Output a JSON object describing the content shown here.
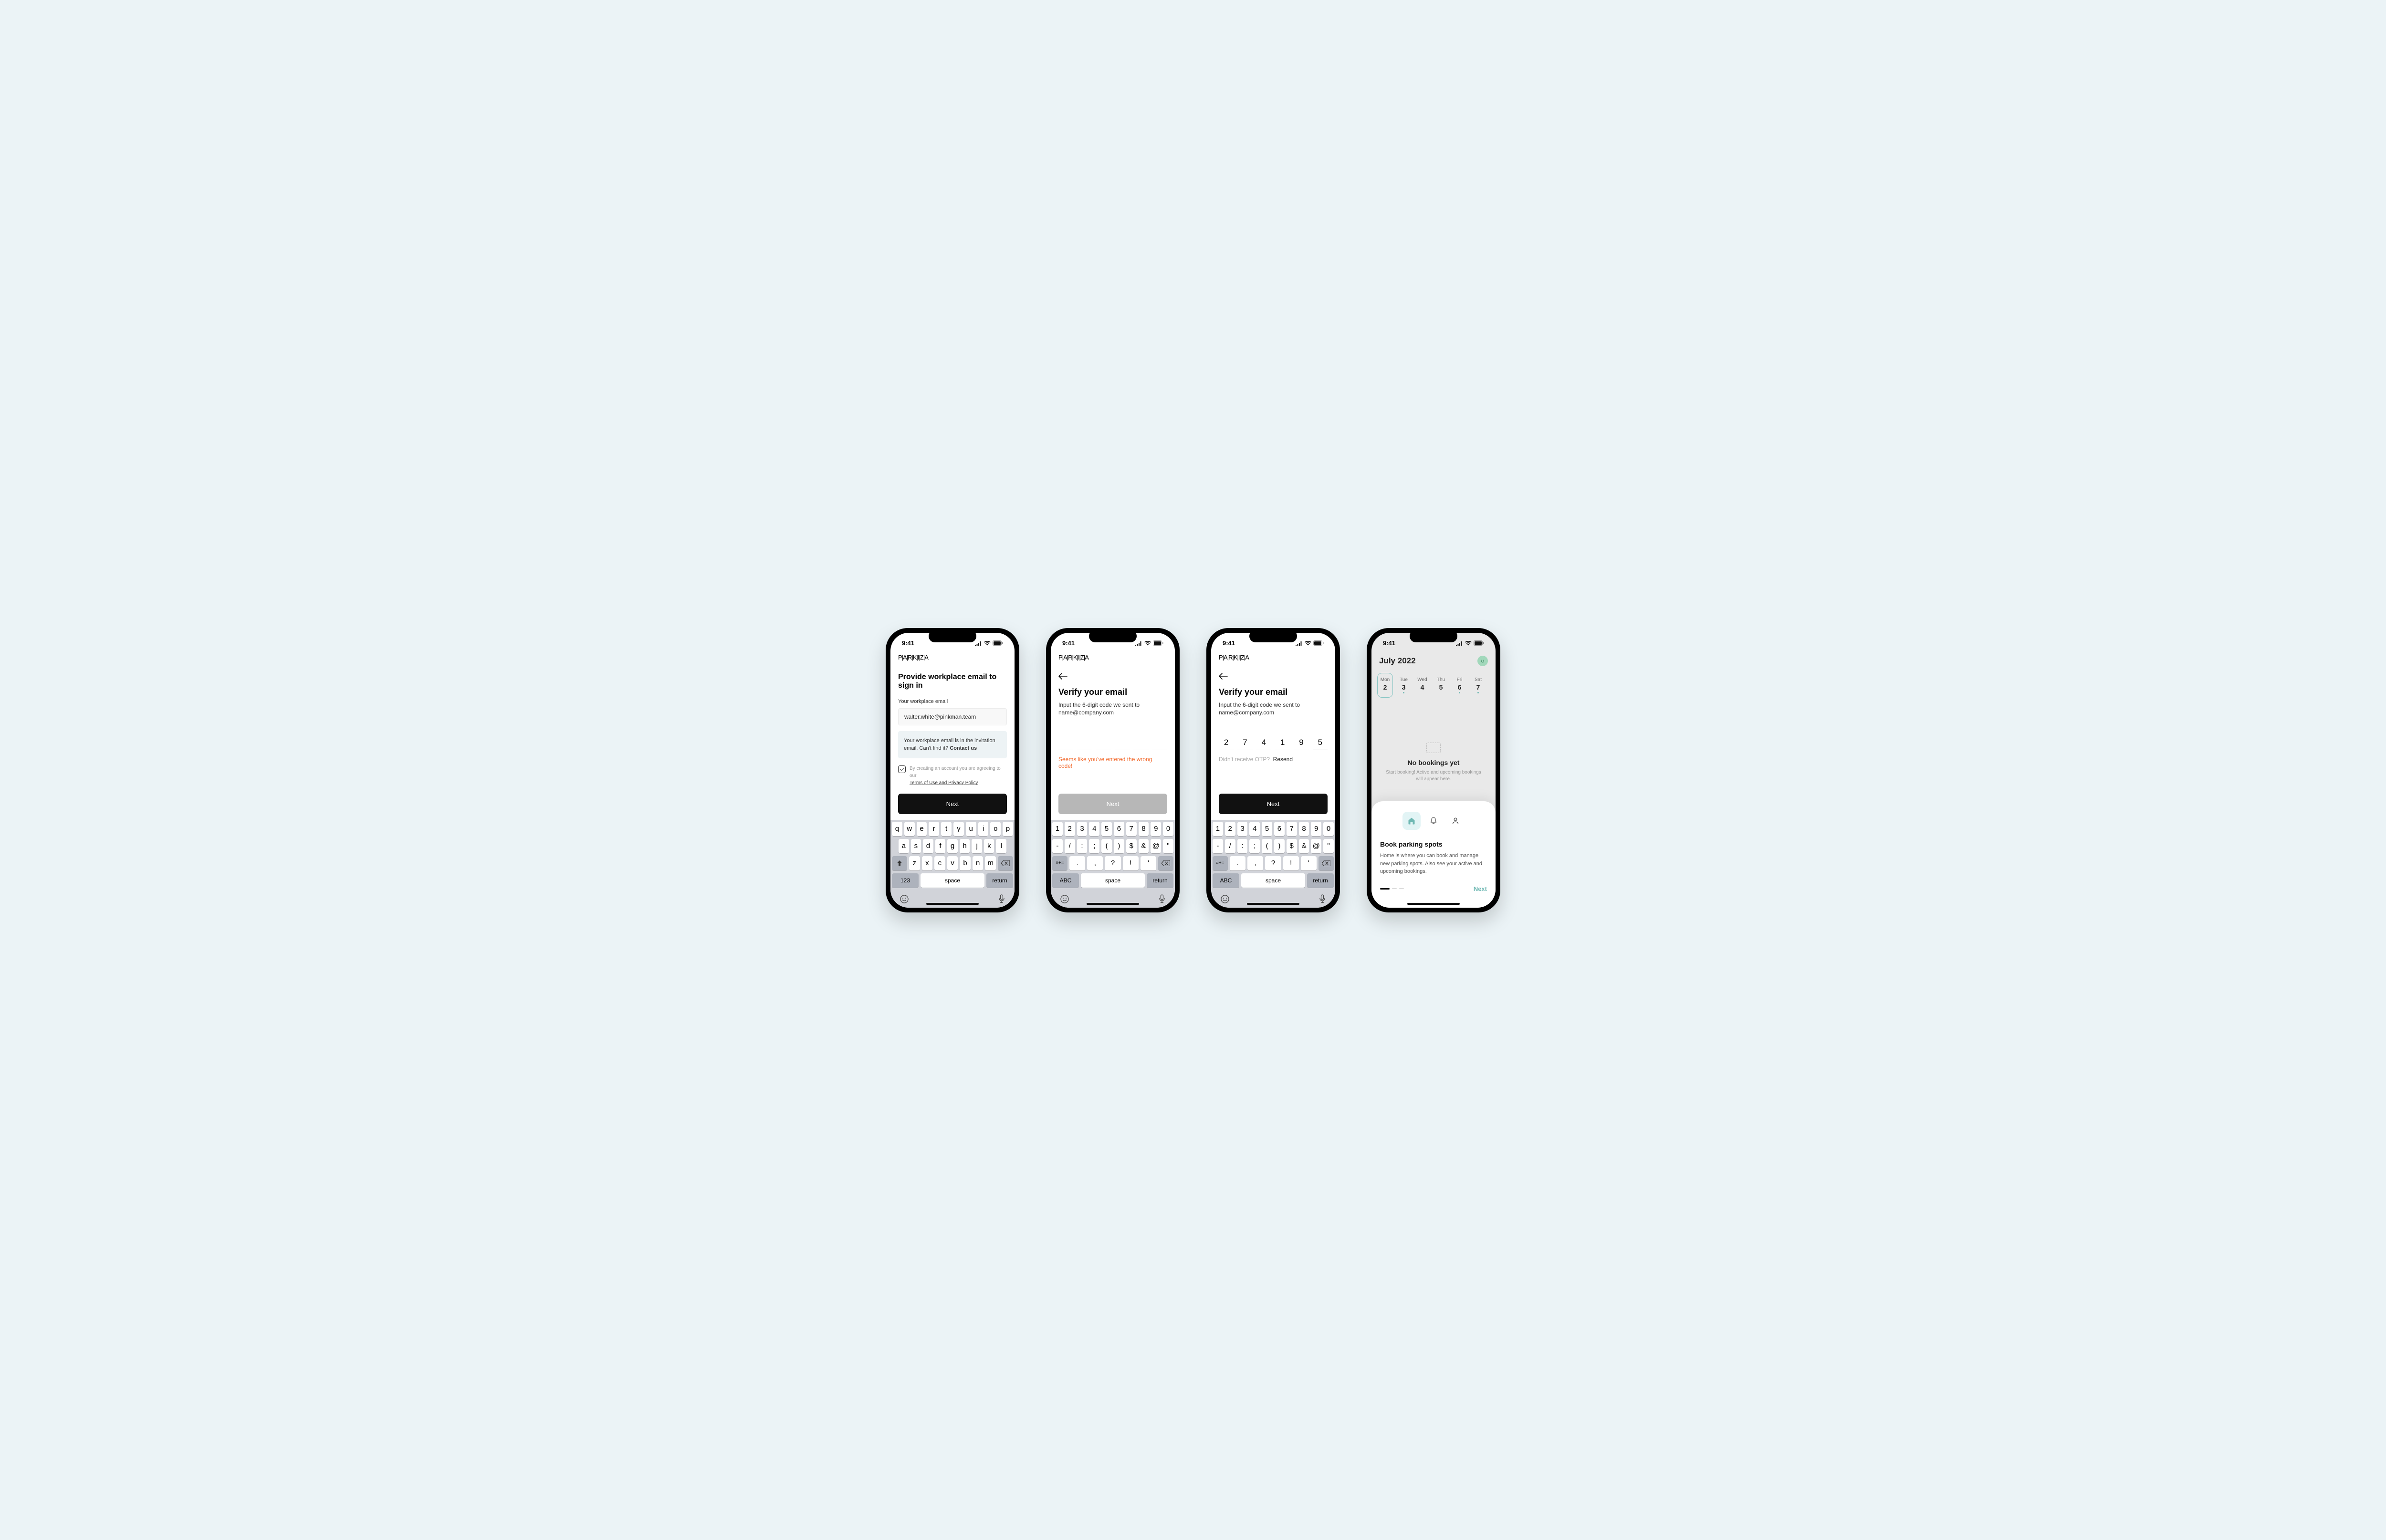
{
  "status_time": "9:41",
  "brand_text": "P|A|R|K|I|Z|A",
  "screen1": {
    "title": "Provide workplace email to sign in",
    "label": "Your workplace email",
    "email_value": "walter.white@pinkman.team",
    "info_text": "Your workplace email is in the invitation email. Can't find it? ",
    "info_link": "Contact us",
    "consent_prefix": "By creating an account you are agreeing to our",
    "consent_link": "Terms of Use and Privacy Policy",
    "next": "Next"
  },
  "screen2": {
    "title": "Verify your email",
    "subtitle": "Input the 6-digit code we sent to name@company.com",
    "error": "Seems like you've entered the wrong code!",
    "next": "Next"
  },
  "screen3": {
    "title": "Verify your email",
    "subtitle": "Input the 6-digit code we sent to name@company.com",
    "otp": [
      "2",
      "7",
      "4",
      "1",
      "9",
      "5"
    ],
    "resend_prefix": "Didn't receive OTP?",
    "resend_link": "Resend",
    "next": "Next"
  },
  "screen4": {
    "month": "July 2022",
    "days": [
      {
        "dow": "Mon",
        "num": "2",
        "selected": true,
        "dot": ""
      },
      {
        "dow": "Tue",
        "num": "3",
        "dot": "teal"
      },
      {
        "dow": "Wed",
        "num": "4",
        "dot": ""
      },
      {
        "dow": "Thu",
        "num": "5",
        "dot": ""
      },
      {
        "dow": "Fri",
        "num": "6",
        "dot": "teal"
      },
      {
        "dow": "Sat",
        "num": "7",
        "dot": "teal"
      }
    ],
    "empty_head": "No bookings yet",
    "empty_sub": "Start booking! Active and upcoming bookings will appear here.",
    "sheet_title": "Book parking spots",
    "sheet_body": "Home is where you can book and manage new parking spots. Also see your active and upcoming bookings.",
    "next": "Next"
  },
  "keyboard": {
    "qwerty": [
      [
        "q",
        "w",
        "e",
        "r",
        "t",
        "y",
        "u",
        "i",
        "o",
        "p"
      ],
      [
        "a",
        "s",
        "d",
        "f",
        "g",
        "h",
        "j",
        "k",
        "l"
      ],
      [
        "z",
        "x",
        "c",
        "v",
        "b",
        "n",
        "m"
      ]
    ],
    "numeric": [
      [
        "1",
        "2",
        "3",
        "4",
        "5",
        "6",
        "7",
        "8",
        "9",
        "0"
      ],
      [
        "-",
        "/",
        ":",
        ";",
        "(",
        ")",
        "$",
        "&",
        "@",
        "\""
      ],
      [
        ".",
        ",",
        "?",
        "!",
        "'"
      ]
    ],
    "space": "space",
    "return": "return",
    "num_key": "123",
    "abc_key": "ABC",
    "sym_key": "#+="
  }
}
